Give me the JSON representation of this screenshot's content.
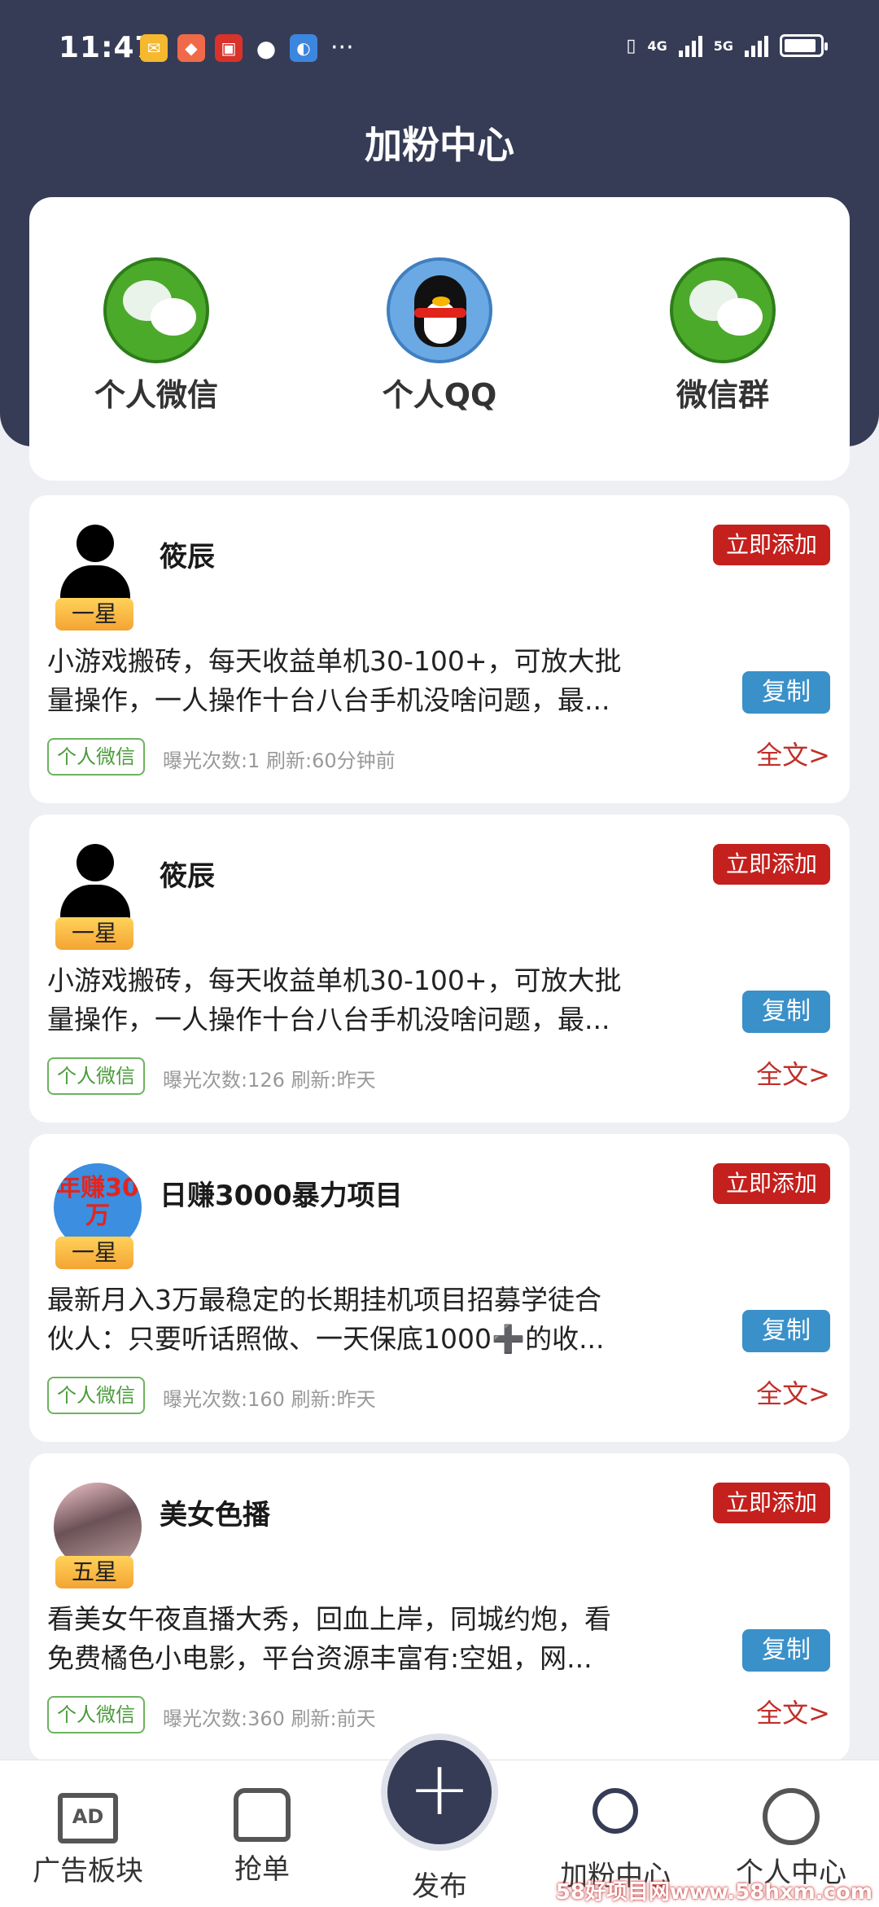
{
  "status_bar": {
    "time": "11:47",
    "more": "···",
    "signal_4g": "4G",
    "signal_5g": "5G"
  },
  "header": {
    "title": "加粉中心"
  },
  "categories": [
    {
      "label": "个人微信",
      "icon": "wechat-icon"
    },
    {
      "label": "个人QQ",
      "icon": "qq-icon"
    },
    {
      "label": "微信群",
      "icon": "wechat-group-icon"
    }
  ],
  "posts": [
    {
      "name": "筱辰",
      "level": "一星",
      "add_label": "立即添加",
      "line1": "小游戏搬砖，每天收益单机30-100+，可放大批",
      "line2": "量操作，一人操作十台八台手机没啥问题，最...",
      "copy_label": "复制",
      "tag": "个人微信",
      "meta": "曝光次数:1 刷新:60分钟前",
      "fulltext": "全文>"
    },
    {
      "name": "筱辰",
      "level": "一星",
      "add_label": "立即添加",
      "line1": "小游戏搬砖，每天收益单机30-100+，可放大批",
      "line2": "量操作，一人操作十台八台手机没啥问题，最...",
      "copy_label": "复制",
      "tag": "个人微信",
      "meta": "曝光次数:126 刷新:昨天",
      "fulltext": "全文>"
    },
    {
      "name": "日赚3000暴力项目",
      "level": "一星",
      "avatar_text": "年赚30万",
      "add_label": "立即添加",
      "line1": "最新月入3万最稳定的长期挂机项目招募学徒合",
      "line2": "伙人：只要听话照做、一天保底1000➕的收...",
      "copy_label": "复制",
      "tag": "个人微信",
      "meta": "曝光次数:160 刷新:昨天",
      "fulltext": "全文>"
    },
    {
      "name": "美女色播",
      "level": "五星",
      "add_label": "立即添加",
      "line1": "看美女午夜直播大秀，回血上岸，同城约炮，看",
      "line2": "免费橘色小电影，平台资源丰富有:空姐，网...",
      "copy_label": "复制",
      "tag": "个人微信",
      "meta": "曝光次数:360 刷新:前天",
      "fulltext": "全文>"
    }
  ],
  "tab_bar": {
    "items": [
      {
        "label": "广告板块",
        "icon": "ad-icon",
        "icon_text": "AD"
      },
      {
        "label": "抢单",
        "icon": "grab-order-icon"
      },
      {
        "label": "发布",
        "icon": "plus-icon",
        "icon_text": "+"
      },
      {
        "label": "加粉中心",
        "icon": "person-heart-icon",
        "active": true
      },
      {
        "label": "个人中心",
        "icon": "profile-icon"
      }
    ]
  },
  "watermark": "58好项目网www.58hxm.com",
  "colors": {
    "header": "#363c56",
    "add_button": "#c4201d",
    "copy_button": "#3a90c9",
    "tag_green": "#4a9c3a",
    "fulltext_red": "#c0302a"
  }
}
